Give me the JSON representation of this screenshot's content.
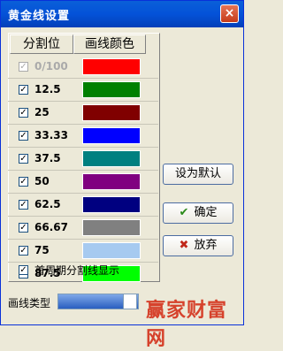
{
  "window": {
    "title": "黄金线设置",
    "close_glyph": "×"
  },
  "table": {
    "headers": [
      "分割位",
      "画线颜色"
    ],
    "rows": [
      {
        "label": "0/100",
        "checked": true,
        "disabled": true,
        "color": "#ff0000"
      },
      {
        "label": "12.5",
        "checked": true,
        "disabled": false,
        "color": "#008000"
      },
      {
        "label": "25",
        "checked": true,
        "disabled": false,
        "color": "#800000"
      },
      {
        "label": "33.33",
        "checked": true,
        "disabled": false,
        "color": "#0000ff"
      },
      {
        "label": "37.5",
        "checked": true,
        "disabled": false,
        "color": "#008080"
      },
      {
        "label": "50",
        "checked": true,
        "disabled": false,
        "color": "#800080"
      },
      {
        "label": "62.5",
        "checked": true,
        "disabled": false,
        "color": "#000080"
      },
      {
        "label": "66.67",
        "checked": true,
        "disabled": false,
        "color": "#808080"
      },
      {
        "label": "75",
        "checked": true,
        "disabled": false,
        "color": "#a6caf0"
      },
      {
        "label": "87.5",
        "checked": true,
        "disabled": false,
        "color": "#00ff00"
      }
    ]
  },
  "buttons": {
    "set_default": "设为默认",
    "ok": "确定",
    "cancel": "放弃"
  },
  "options": {
    "first_cycle_label": "首周期分割线显示",
    "first_cycle_checked": true
  },
  "line_type": {
    "label": "画线类型"
  },
  "watermark": {
    "text": "赢家财富网"
  }
}
